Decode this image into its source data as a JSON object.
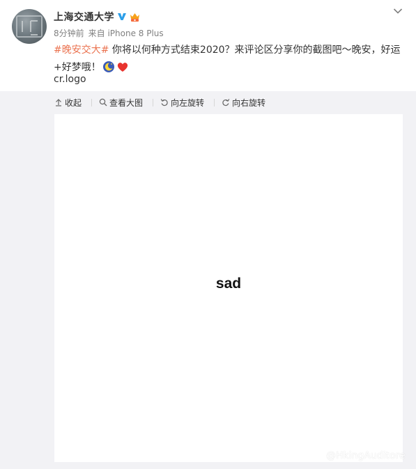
{
  "post": {
    "author": "上海交通大学",
    "time": "8分钟前",
    "source": "来自 iPhone 8 Plus",
    "hashtag": "#晚安交大#",
    "text": " 你将以何种方式结束2020？来评论区分享你的截图吧～晚安，好运+好梦哦！",
    "link": "cr.logo",
    "emojis": [
      "moon-stars-emoji",
      "red-heart-emoji"
    ]
  },
  "toolbar": {
    "collapse": "收起",
    "view_large": "查看大图",
    "rotate_left": "向左旋转",
    "rotate_right": "向右旋转"
  },
  "image": {
    "caption": "sad"
  },
  "watermark": {
    "text": "@HkingAuditore"
  },
  "colors": {
    "hashtag": "#eb7350",
    "verified": "#2c9ee8",
    "background": "#f2f2f5"
  }
}
